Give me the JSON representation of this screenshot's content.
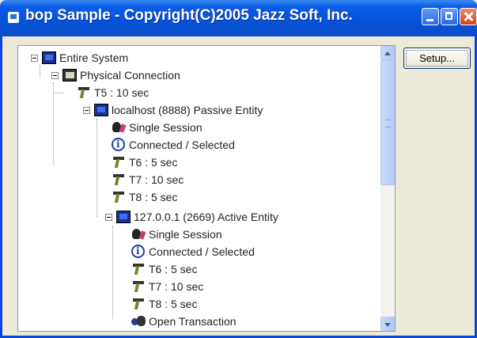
{
  "window": {
    "title": "bop Sample - Copyright(C)2005 Jazz Soft, Inc."
  },
  "setup_button": {
    "label": "Setup..."
  },
  "tree": {
    "entire_system": "Entire System",
    "physical_connection": "Physical Connection",
    "t5": "T5 : 10 sec",
    "localhost": "localhost (8888) Passive Entity",
    "lh_session": "Single Session",
    "lh_connected": "Connected / Selected",
    "lh_t6": "T6 : 5 sec",
    "lh_t7": "T7 : 10 sec",
    "lh_t8": "T8 : 5 sec",
    "remote": "127.0.0.1 (2669) Active Entity",
    "rm_session": "Single Session",
    "rm_connected": "Connected / Selected",
    "rm_t6": "T6 : 5 sec",
    "rm_t7": "T7 : 10 sec",
    "rm_t8": "T8 : 5 sec",
    "rm_transaction": "Open Transaction"
  },
  "icons": {
    "entire_system": "monitor-icon",
    "physical_connection": "connection-icon",
    "timer": "timer-icon",
    "entity": "monitor-icon",
    "session": "session-icon",
    "connected": "info-icon",
    "transaction": "transaction-icon"
  },
  "colors": {
    "titlebar": "#0752d8",
    "tree_background": "#ffffff",
    "dialog_background": "#ece9d8"
  }
}
